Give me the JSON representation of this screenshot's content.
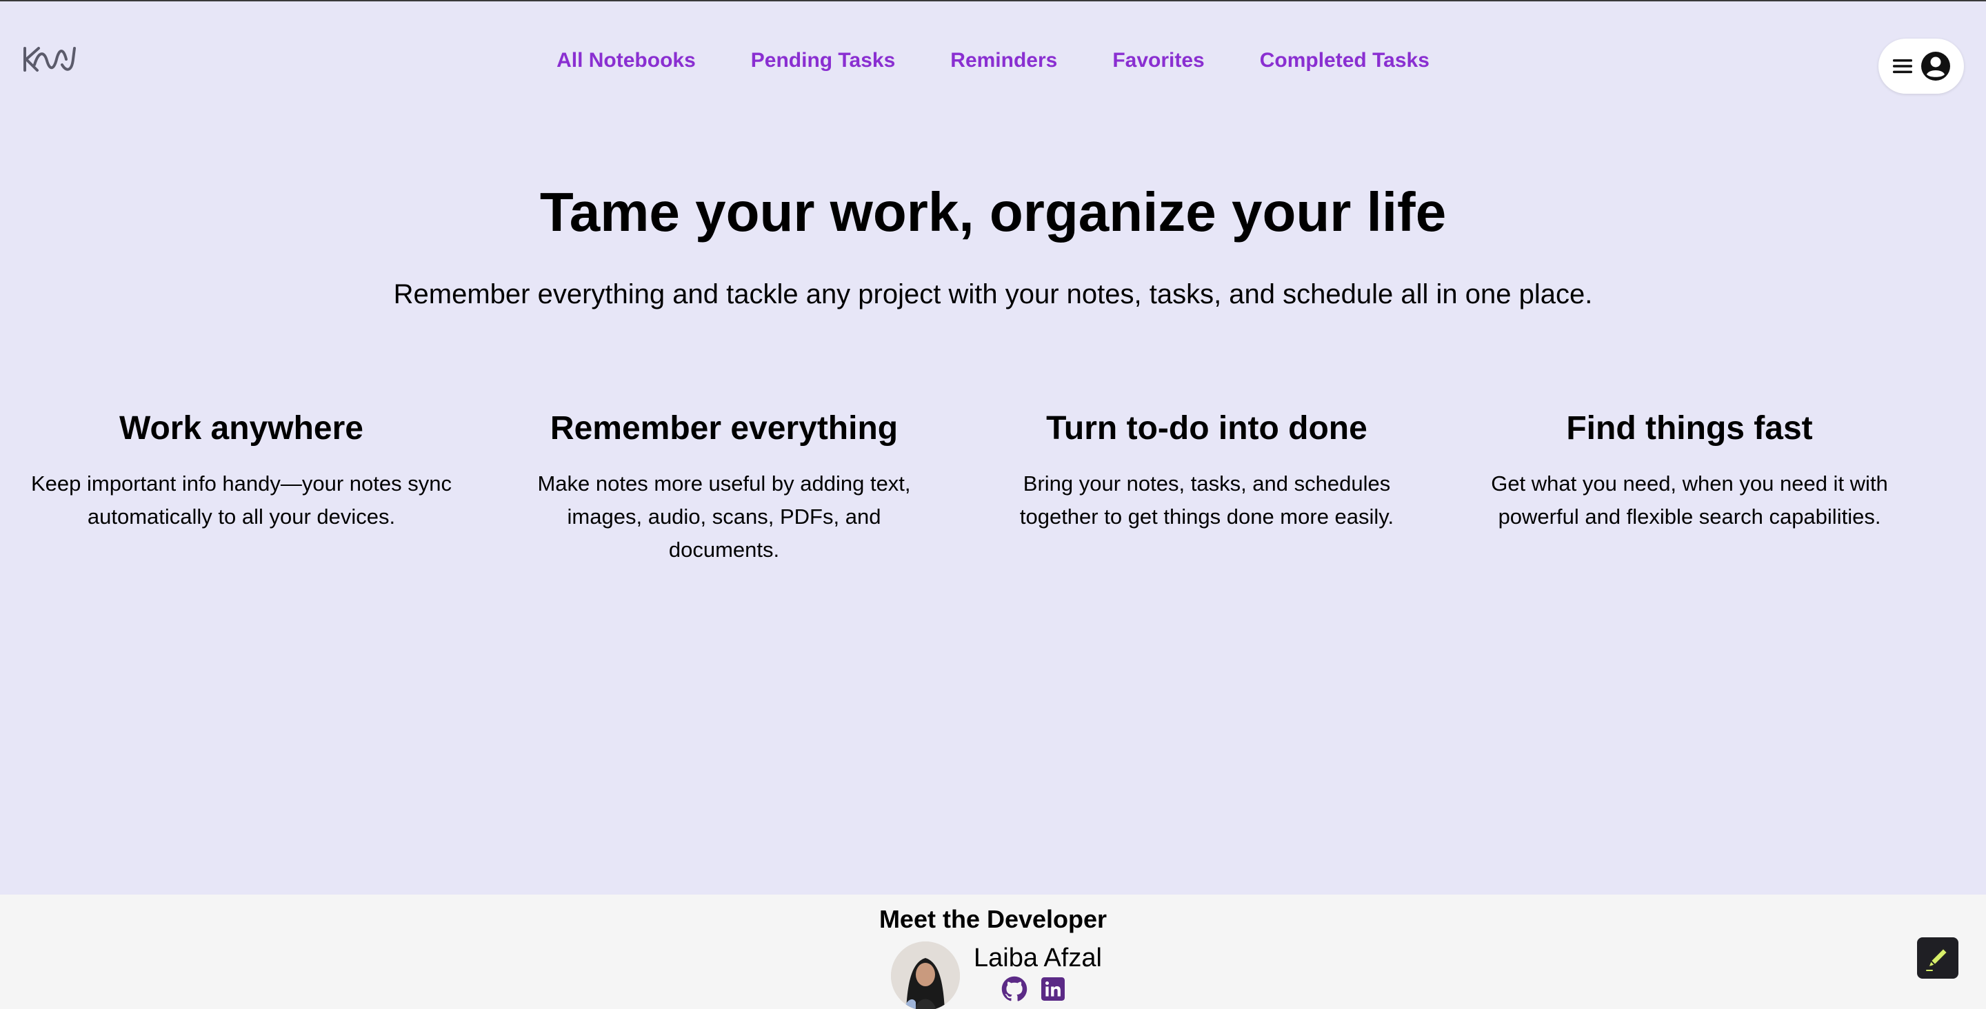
{
  "header": {
    "logo_text": "KNW",
    "nav": [
      {
        "label": "All Notebooks"
      },
      {
        "label": "Pending Tasks"
      },
      {
        "label": "Reminders"
      },
      {
        "label": "Favorites"
      },
      {
        "label": "Completed Tasks"
      }
    ],
    "menu_icon": "hamburger-icon",
    "account_icon": "user-circle-icon"
  },
  "hero": {
    "title": "Tame your work, organize your life",
    "subtitle": "Remember everything and tackle any project with your notes, tasks, and schedule all in one place."
  },
  "features": [
    {
      "title": "Work anywhere",
      "text": "Keep important info handy—your notes sync automatically to all your devices."
    },
    {
      "title": "Remember everything",
      "text": "Make notes more useful by adding text, images, audio, scans, PDFs, and documents."
    },
    {
      "title": "Turn to-do into done",
      "text": "Bring your notes, tasks, and schedules together to get things done more easily."
    },
    {
      "title": "Find things fast",
      "text": "Get what you need, when you need it with powerful and flexible search capabilities."
    }
  ],
  "footer": {
    "title": "Meet the Developer",
    "developer_name": "Laiba Afzal",
    "icons": [
      "github-icon",
      "linkedin-icon"
    ]
  },
  "floating_button": {
    "icon": "pen-icon"
  },
  "colors": {
    "background": "#e7e6f7",
    "nav_link": "#8a2fd1",
    "footer_bg": "#f5f5f5",
    "icon_purple": "#5b2a86"
  }
}
